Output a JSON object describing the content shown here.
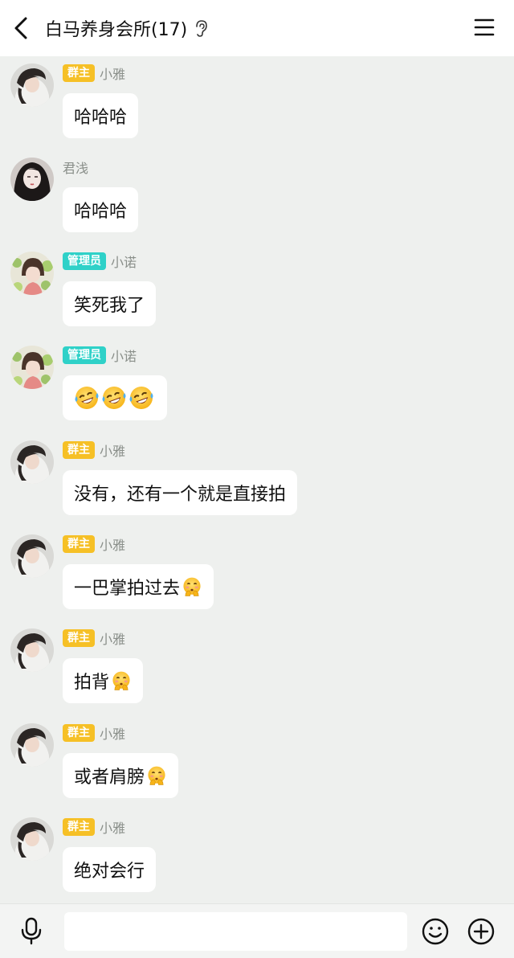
{
  "header": {
    "title": "白马养身会所(17)",
    "back_icon": "chevron-left-icon",
    "ear_icon": "ear-icon",
    "menu_icon": "hamburger-menu-icon"
  },
  "messages": [
    {
      "badge": "群主",
      "badge_type": "owner",
      "nick": "小雅",
      "text": "哈哈哈",
      "emoji": ""
    },
    {
      "badge": "",
      "badge_type": "",
      "nick": "君浅",
      "text": "哈哈哈",
      "emoji": ""
    },
    {
      "badge": "管理员",
      "badge_type": "admin",
      "nick": "小诺",
      "text": "笑死我了",
      "emoji": ""
    },
    {
      "badge": "管理员",
      "badge_type": "admin",
      "nick": "小诺",
      "text": "",
      "emoji": "laughing-crying-emoji x3"
    },
    {
      "badge": "群主",
      "badge_type": "owner",
      "nick": "小雅",
      "text": "没有，还有一个就是直接拍",
      "emoji": ""
    },
    {
      "badge": "群主",
      "badge_type": "owner",
      "nick": "小雅",
      "text": "一巴掌拍过去",
      "emoji": "shy-emoji"
    },
    {
      "badge": "群主",
      "badge_type": "owner",
      "nick": "小雅",
      "text": "拍背",
      "emoji": "shy-emoji"
    },
    {
      "badge": "群主",
      "badge_type": "owner",
      "nick": "小雅",
      "text": "或者肩膀",
      "emoji": "shy-emoji"
    },
    {
      "badge": "群主",
      "badge_type": "owner",
      "nick": "小雅",
      "text": "绝对会行",
      "emoji": ""
    }
  ],
  "bottom_bar": {
    "mic_icon": "microphone-icon",
    "input_value": "",
    "smile_icon": "smiley-face-icon",
    "plus_icon": "plus-circle-icon"
  },
  "colors": {
    "background": "#eef0ee",
    "owner_badge": "#f6c026",
    "admin_badge": "#2fd1c8"
  }
}
